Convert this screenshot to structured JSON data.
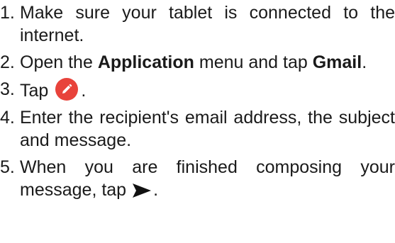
{
  "steps": [
    {
      "number": "1.",
      "text": "Make sure your tablet is connected to the internet."
    },
    {
      "number": "2.",
      "pre": "Open the ",
      "bold1": "Application",
      "mid": " menu and tap ",
      "bold2": "Gmail",
      "post": "."
    },
    {
      "number": "3.",
      "pre": "Tap",
      "icon": "compose-pencil-icon",
      "post": ".",
      "icon_color": "#e8433b"
    },
    {
      "number": "4.",
      "text": "Enter the recipient's email address, the subject and message."
    },
    {
      "number": "5.",
      "pre": "When you are finished composing your message, tap",
      "icon": "send-arrow-icon",
      "post": "."
    }
  ]
}
